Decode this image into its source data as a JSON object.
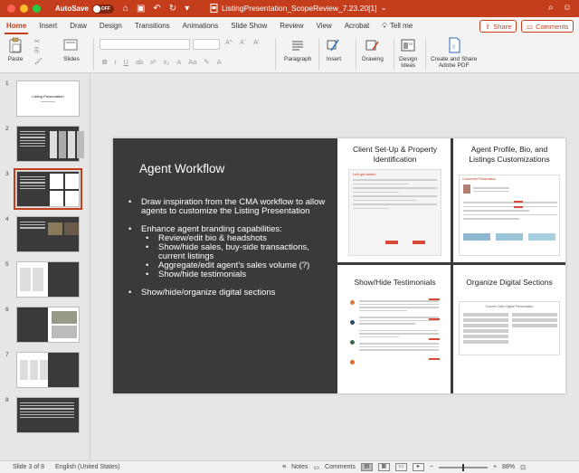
{
  "titlebar": {
    "autosave_label": "AutoSave",
    "autosave_state": "OFF",
    "doc_title": "ListingPresentation_ScopeReview_7.23.20[1]",
    "color": "#c43e1c"
  },
  "tabs": [
    {
      "label": "Home",
      "active": true
    },
    {
      "label": "Insert"
    },
    {
      "label": "Draw"
    },
    {
      "label": "Design"
    },
    {
      "label": "Transitions"
    },
    {
      "label": "Animations"
    },
    {
      "label": "Slide Show"
    },
    {
      "label": "Review"
    },
    {
      "label": "View"
    },
    {
      "label": "Acrobat"
    }
  ],
  "tell_me": "Tell me",
  "share_label": "Share",
  "comments_label": "Comments",
  "toolbar": {
    "paste": "Paste",
    "slides": "Slides",
    "paragraph": "Paragraph",
    "insert": "Insert",
    "drawing": "Drawing",
    "design_ideas_1": "Design",
    "design_ideas_2": "Ideas",
    "adobe_1": "Create and Share",
    "adobe_2": "Adobe PDF"
  },
  "thumbnails": [
    {
      "num": "1",
      "title": "Listing Presentation"
    },
    {
      "num": "2"
    },
    {
      "num": "3"
    },
    {
      "num": "4"
    },
    {
      "num": "5"
    },
    {
      "num": "6"
    },
    {
      "num": "7"
    },
    {
      "num": "8"
    }
  ],
  "slide": {
    "title": "Agent Workflow",
    "bullets": [
      {
        "text": "Draw inspiration from the CMA workflow to allow agents to customize the Listing Presentation"
      },
      {
        "text": "Enhance agent branding capabilities:"
      },
      {
        "sub": [
          "Review/edit bio & headshots",
          "Show/hide sales, buy-side transactions, current listings",
          "Aggregate/edit agent’s sales volume (?)",
          "Show/hide testimonials"
        ]
      },
      {
        "text": "Show/hide/organize digital sections"
      }
    ],
    "panels": {
      "top_left": "Client Set-Up & Property Identification",
      "top_right": "Agent Profile, Bio, and Listings Customizations",
      "bottom_left": "Show/Hide Testimonials",
      "bottom_right": "Organize Digital Sections"
    },
    "mock_text": {
      "top_right_heading": "Customize Presentation",
      "bottom_right_heading": "Current Order Digital Presentation",
      "top_left_heading": "Let's get started"
    }
  },
  "status": {
    "slide_of": "Slide 3 of 8",
    "language": "English (United States)",
    "notes": "Notes",
    "comments": "Comments",
    "zoom": "88%"
  }
}
